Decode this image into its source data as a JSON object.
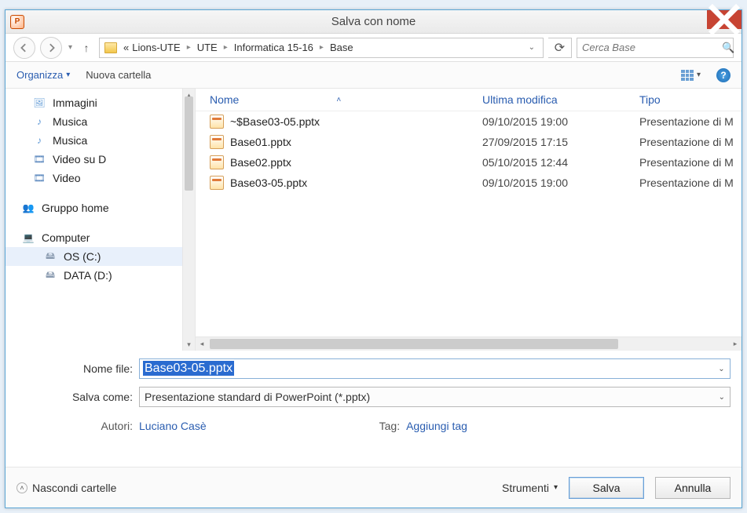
{
  "window": {
    "title": "Salva con nome"
  },
  "breadcrumb": {
    "prefix": "«",
    "items": [
      "Lions-UTE",
      "UTE",
      "Informatica 15-16",
      "Base"
    ]
  },
  "search": {
    "placeholder": "Cerca Base"
  },
  "toolbar": {
    "organize": "Organizza",
    "new_folder": "Nuova cartella"
  },
  "sidebar": {
    "items": [
      {
        "label": "Immagini",
        "iconClass": "pics",
        "glyph": "🖼"
      },
      {
        "label": "Musica",
        "iconClass": "music",
        "glyph": "♪"
      },
      {
        "label": "Musica",
        "iconClass": "music",
        "glyph": "♪"
      },
      {
        "label": "Video su D",
        "iconClass": "vid",
        "glyph": "🎞"
      },
      {
        "label": "Video",
        "iconClass": "vid",
        "glyph": "🎞"
      }
    ],
    "homegroup": {
      "label": "Gruppo home",
      "glyph": "👥"
    },
    "computer": {
      "label": "Computer",
      "glyph": "💻"
    },
    "drives": [
      {
        "label": "OS (C:)",
        "glyph": "🖴"
      },
      {
        "label": "DATA (D:)",
        "glyph": "🖴"
      }
    ]
  },
  "columns": {
    "name": "Nome",
    "modified": "Ultima modifica",
    "type": "Tipo"
  },
  "files": [
    {
      "name": "~$Base03-05.pptx",
      "modified": "09/10/2015 19:00",
      "type": "Presentazione di M"
    },
    {
      "name": "Base01.pptx",
      "modified": "27/09/2015 17:15",
      "type": "Presentazione di M"
    },
    {
      "name": "Base02.pptx",
      "modified": "05/10/2015 12:44",
      "type": "Presentazione di M"
    },
    {
      "name": "Base03-05.pptx",
      "modified": "09/10/2015 19:00",
      "type": "Presentazione di M"
    }
  ],
  "form": {
    "filename_label": "Nome file:",
    "filename_value": "Base03-05.pptx",
    "saveas_label": "Salva come:",
    "saveas_value": "Presentazione standard di PowerPoint (*.pptx)",
    "authors_label": "Autori:",
    "authors_value": "Luciano Casè",
    "tag_label": "Tag:",
    "tag_value": "Aggiungi tag"
  },
  "footer": {
    "hide_folders": "Nascondi cartelle",
    "tools": "Strumenti",
    "save": "Salva",
    "cancel": "Annulla"
  }
}
